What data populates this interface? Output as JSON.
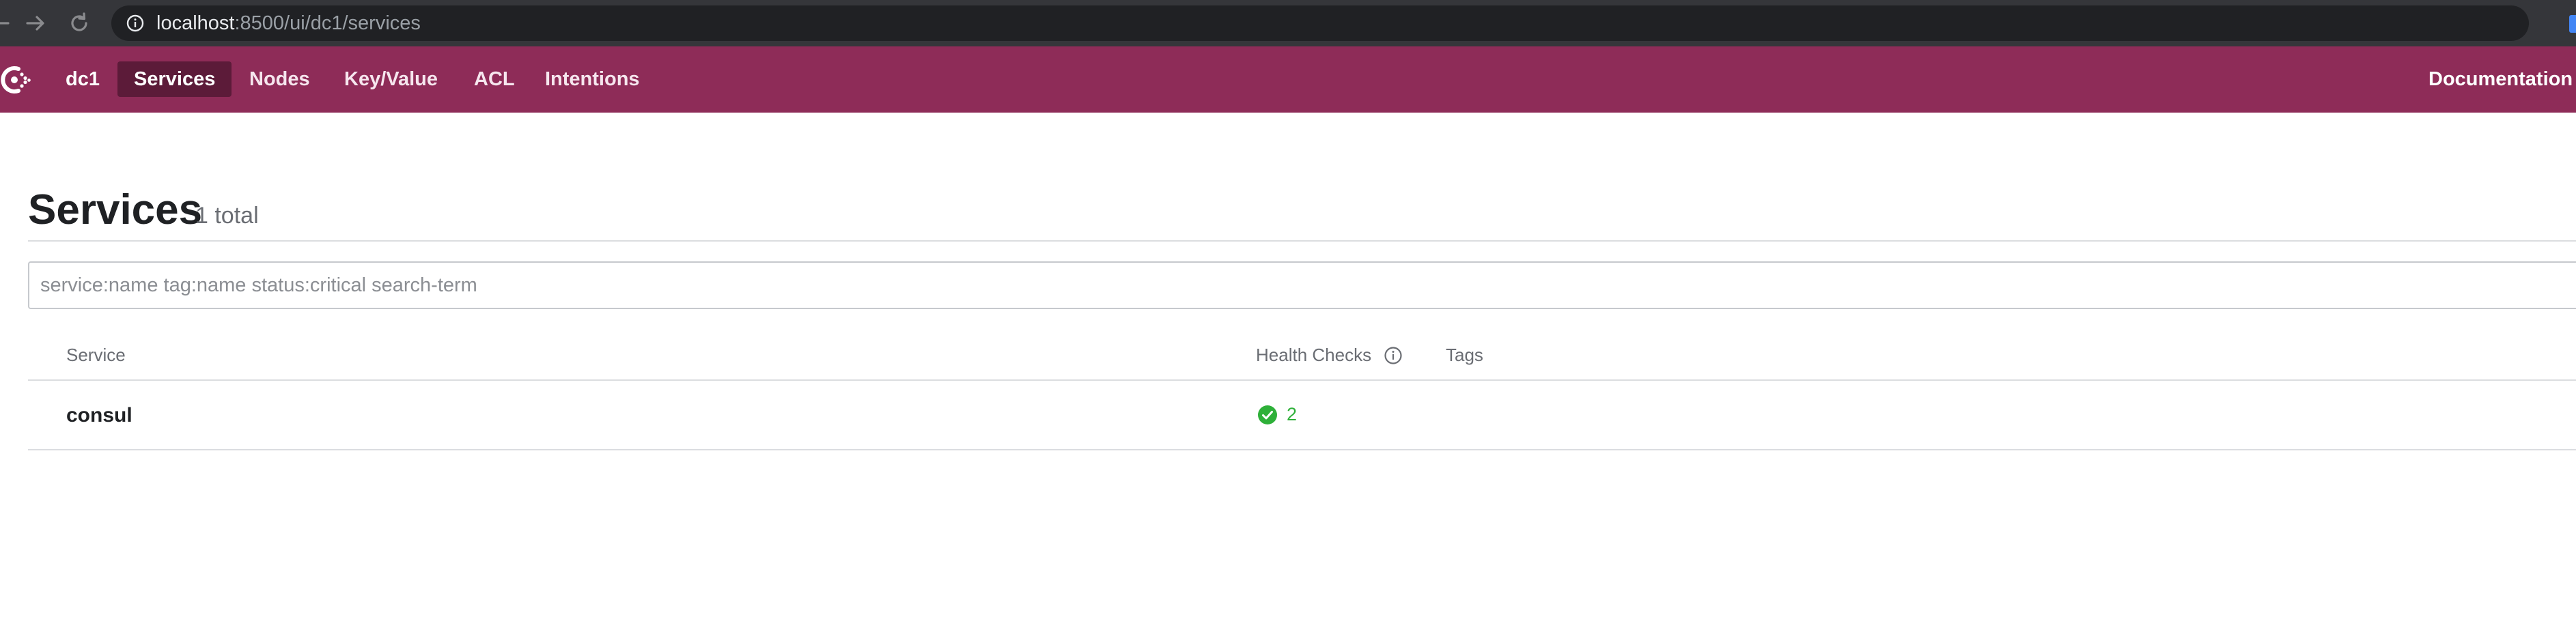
{
  "browser": {
    "url_host": "localhost",
    "url_rest": ":8500/ui/dc1/services",
    "back_icon": "arrow-left-icon",
    "forward_icon": "arrow-right-icon",
    "reload_icon": "reload-icon",
    "bookmark_icon": "star-icon"
  },
  "header": {
    "datacenter": "dc1",
    "tabs": [
      {
        "label": "Services",
        "active": true
      },
      {
        "label": "Nodes"
      },
      {
        "label": "Key/Value"
      },
      {
        "label": "ACL"
      },
      {
        "label": "Intentions"
      }
    ],
    "documentation": "Documentation",
    "brand_color": "#8e2c58",
    "active_tab_color": "#5c1b39"
  },
  "page": {
    "title": "Services",
    "count": "1 total"
  },
  "search": {
    "placeholder": "service:name tag:name status:critical search-term"
  },
  "table": {
    "columns": [
      "Service",
      "Health Checks",
      "Tags"
    ],
    "rows": [
      {
        "service": "consul",
        "health_passing": "2",
        "tags": ""
      }
    ]
  },
  "colors": {
    "passing": "#2eb039"
  }
}
